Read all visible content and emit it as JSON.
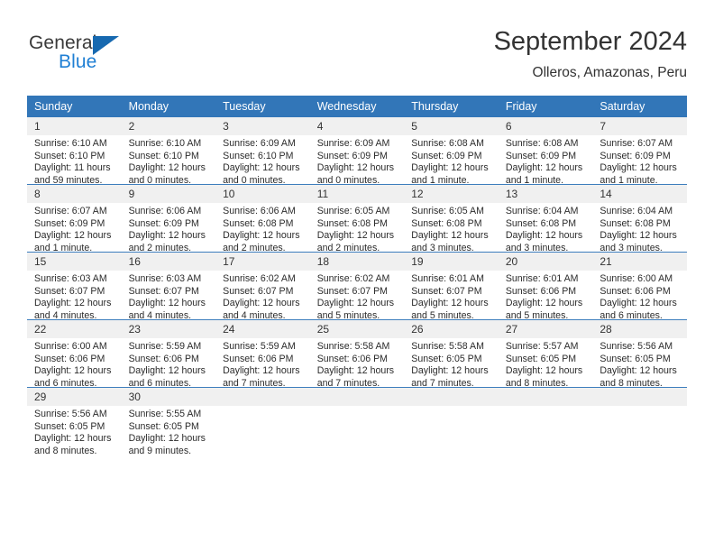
{
  "brand": {
    "name_top": "General",
    "name_bottom": "Blue",
    "triangle_icon": "triangle-icon",
    "color_dark": "#3a3a3a",
    "color_blue": "#1f7fd4"
  },
  "header": {
    "title": "September 2024",
    "location": "Olleros, Amazonas, Peru"
  },
  "theme": {
    "header_bg": "#3276b8",
    "header_text": "#ffffff",
    "daynum_bg": "#f0f0f0",
    "row_divider": "#3d7ebd",
    "body_text": "#2b2b2b"
  },
  "calendar": {
    "weekdays": [
      "Sunday",
      "Monday",
      "Tuesday",
      "Wednesday",
      "Thursday",
      "Friday",
      "Saturday"
    ],
    "weeks": [
      [
        {
          "day": "1",
          "sunrise": "Sunrise: 6:10 AM",
          "sunset": "Sunset: 6:10 PM",
          "daylight1": "Daylight: 11 hours",
          "daylight2": "and 59 minutes."
        },
        {
          "day": "2",
          "sunrise": "Sunrise: 6:10 AM",
          "sunset": "Sunset: 6:10 PM",
          "daylight1": "Daylight: 12 hours",
          "daylight2": "and 0 minutes."
        },
        {
          "day": "3",
          "sunrise": "Sunrise: 6:09 AM",
          "sunset": "Sunset: 6:10 PM",
          "daylight1": "Daylight: 12 hours",
          "daylight2": "and 0 minutes."
        },
        {
          "day": "4",
          "sunrise": "Sunrise: 6:09 AM",
          "sunset": "Sunset: 6:09 PM",
          "daylight1": "Daylight: 12 hours",
          "daylight2": "and 0 minutes."
        },
        {
          "day": "5",
          "sunrise": "Sunrise: 6:08 AM",
          "sunset": "Sunset: 6:09 PM",
          "daylight1": "Daylight: 12 hours",
          "daylight2": "and 1 minute."
        },
        {
          "day": "6",
          "sunrise": "Sunrise: 6:08 AM",
          "sunset": "Sunset: 6:09 PM",
          "daylight1": "Daylight: 12 hours",
          "daylight2": "and 1 minute."
        },
        {
          "day": "7",
          "sunrise": "Sunrise: 6:07 AM",
          "sunset": "Sunset: 6:09 PM",
          "daylight1": "Daylight: 12 hours",
          "daylight2": "and 1 minute."
        }
      ],
      [
        {
          "day": "8",
          "sunrise": "Sunrise: 6:07 AM",
          "sunset": "Sunset: 6:09 PM",
          "daylight1": "Daylight: 12 hours",
          "daylight2": "and 1 minute."
        },
        {
          "day": "9",
          "sunrise": "Sunrise: 6:06 AM",
          "sunset": "Sunset: 6:09 PM",
          "daylight1": "Daylight: 12 hours",
          "daylight2": "and 2 minutes."
        },
        {
          "day": "10",
          "sunrise": "Sunrise: 6:06 AM",
          "sunset": "Sunset: 6:08 PM",
          "daylight1": "Daylight: 12 hours",
          "daylight2": "and 2 minutes."
        },
        {
          "day": "11",
          "sunrise": "Sunrise: 6:05 AM",
          "sunset": "Sunset: 6:08 PM",
          "daylight1": "Daylight: 12 hours",
          "daylight2": "and 2 minutes."
        },
        {
          "day": "12",
          "sunrise": "Sunrise: 6:05 AM",
          "sunset": "Sunset: 6:08 PM",
          "daylight1": "Daylight: 12 hours",
          "daylight2": "and 3 minutes."
        },
        {
          "day": "13",
          "sunrise": "Sunrise: 6:04 AM",
          "sunset": "Sunset: 6:08 PM",
          "daylight1": "Daylight: 12 hours",
          "daylight2": "and 3 minutes."
        },
        {
          "day": "14",
          "sunrise": "Sunrise: 6:04 AM",
          "sunset": "Sunset: 6:08 PM",
          "daylight1": "Daylight: 12 hours",
          "daylight2": "and 3 minutes."
        }
      ],
      [
        {
          "day": "15",
          "sunrise": "Sunrise: 6:03 AM",
          "sunset": "Sunset: 6:07 PM",
          "daylight1": "Daylight: 12 hours",
          "daylight2": "and 4 minutes."
        },
        {
          "day": "16",
          "sunrise": "Sunrise: 6:03 AM",
          "sunset": "Sunset: 6:07 PM",
          "daylight1": "Daylight: 12 hours",
          "daylight2": "and 4 minutes."
        },
        {
          "day": "17",
          "sunrise": "Sunrise: 6:02 AM",
          "sunset": "Sunset: 6:07 PM",
          "daylight1": "Daylight: 12 hours",
          "daylight2": "and 4 minutes."
        },
        {
          "day": "18",
          "sunrise": "Sunrise: 6:02 AM",
          "sunset": "Sunset: 6:07 PM",
          "daylight1": "Daylight: 12 hours",
          "daylight2": "and 5 minutes."
        },
        {
          "day": "19",
          "sunrise": "Sunrise: 6:01 AM",
          "sunset": "Sunset: 6:07 PM",
          "daylight1": "Daylight: 12 hours",
          "daylight2": "and 5 minutes."
        },
        {
          "day": "20",
          "sunrise": "Sunrise: 6:01 AM",
          "sunset": "Sunset: 6:06 PM",
          "daylight1": "Daylight: 12 hours",
          "daylight2": "and 5 minutes."
        },
        {
          "day": "21",
          "sunrise": "Sunrise: 6:00 AM",
          "sunset": "Sunset: 6:06 PM",
          "daylight1": "Daylight: 12 hours",
          "daylight2": "and 6 minutes."
        }
      ],
      [
        {
          "day": "22",
          "sunrise": "Sunrise: 6:00 AM",
          "sunset": "Sunset: 6:06 PM",
          "daylight1": "Daylight: 12 hours",
          "daylight2": "and 6 minutes."
        },
        {
          "day": "23",
          "sunrise": "Sunrise: 5:59 AM",
          "sunset": "Sunset: 6:06 PM",
          "daylight1": "Daylight: 12 hours",
          "daylight2": "and 6 minutes."
        },
        {
          "day": "24",
          "sunrise": "Sunrise: 5:59 AM",
          "sunset": "Sunset: 6:06 PM",
          "daylight1": "Daylight: 12 hours",
          "daylight2": "and 7 minutes."
        },
        {
          "day": "25",
          "sunrise": "Sunrise: 5:58 AM",
          "sunset": "Sunset: 6:06 PM",
          "daylight1": "Daylight: 12 hours",
          "daylight2": "and 7 minutes."
        },
        {
          "day": "26",
          "sunrise": "Sunrise: 5:58 AM",
          "sunset": "Sunset: 6:05 PM",
          "daylight1": "Daylight: 12 hours",
          "daylight2": "and 7 minutes."
        },
        {
          "day": "27",
          "sunrise": "Sunrise: 5:57 AM",
          "sunset": "Sunset: 6:05 PM",
          "daylight1": "Daylight: 12 hours",
          "daylight2": "and 8 minutes."
        },
        {
          "day": "28",
          "sunrise": "Sunrise: 5:56 AM",
          "sunset": "Sunset: 6:05 PM",
          "daylight1": "Daylight: 12 hours",
          "daylight2": "and 8 minutes."
        }
      ],
      [
        {
          "day": "29",
          "sunrise": "Sunrise: 5:56 AM",
          "sunset": "Sunset: 6:05 PM",
          "daylight1": "Daylight: 12 hours",
          "daylight2": "and 8 minutes."
        },
        {
          "day": "30",
          "sunrise": "Sunrise: 5:55 AM",
          "sunset": "Sunset: 6:05 PM",
          "daylight1": "Daylight: 12 hours",
          "daylight2": "and 9 minutes."
        },
        {
          "day": "",
          "sunrise": "",
          "sunset": "",
          "daylight1": "",
          "daylight2": ""
        },
        {
          "day": "",
          "sunrise": "",
          "sunset": "",
          "daylight1": "",
          "daylight2": ""
        },
        {
          "day": "",
          "sunrise": "",
          "sunset": "",
          "daylight1": "",
          "daylight2": ""
        },
        {
          "day": "",
          "sunrise": "",
          "sunset": "",
          "daylight1": "",
          "daylight2": ""
        },
        {
          "day": "",
          "sunrise": "",
          "sunset": "",
          "daylight1": "",
          "daylight2": ""
        }
      ]
    ]
  }
}
